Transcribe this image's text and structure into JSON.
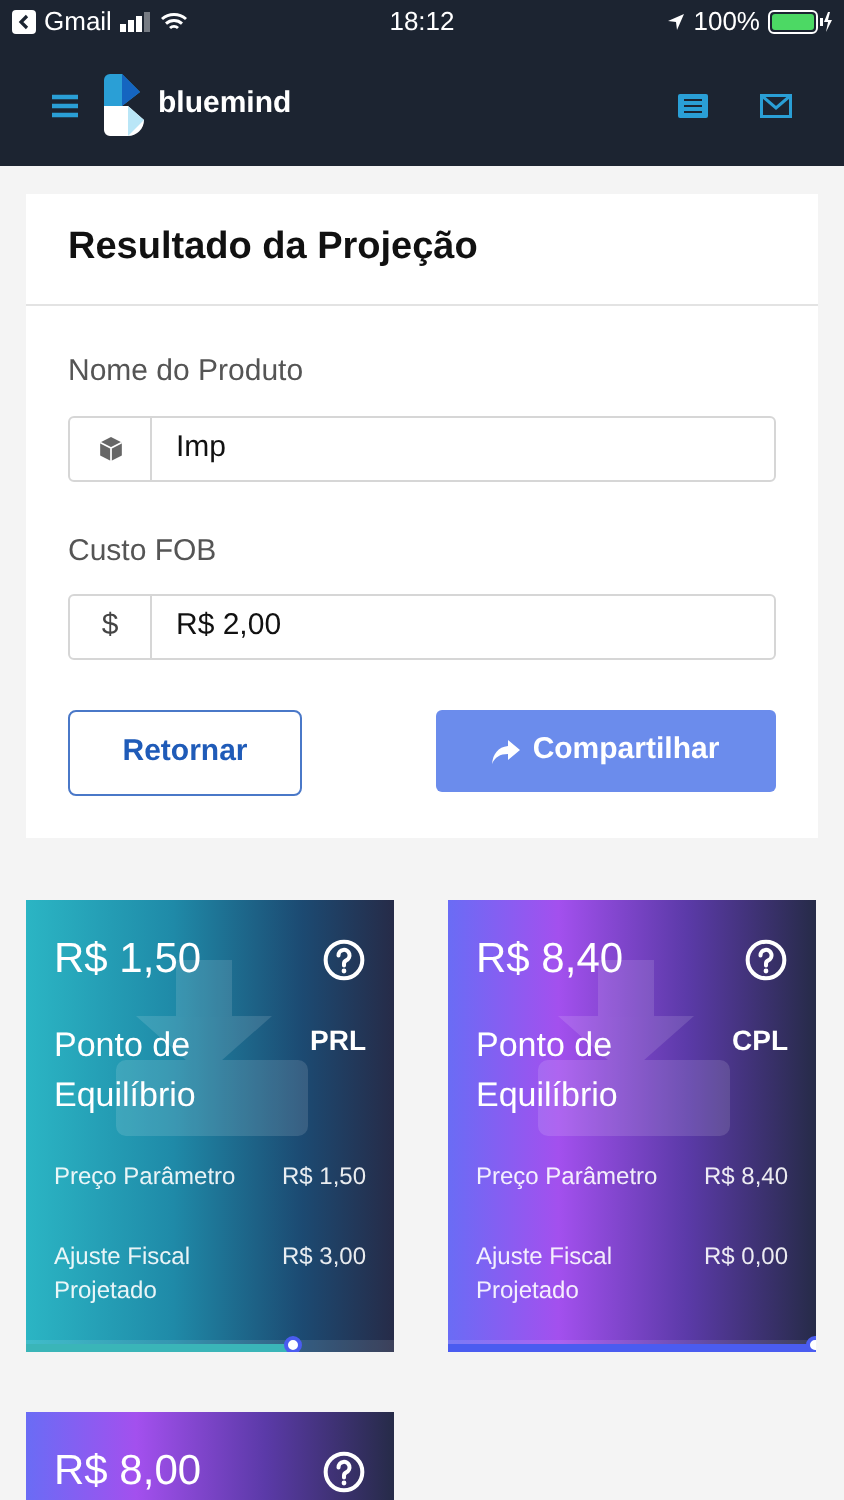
{
  "status_bar": {
    "back_app": "Gmail",
    "time": "18:12",
    "battery": "100%"
  },
  "header": {
    "brand": "bluemind"
  },
  "form": {
    "title": "Resultado da Projeção",
    "fields": [
      {
        "label": "Nome do Produto",
        "kind": "box",
        "value": "Imp"
      },
      {
        "label": "Custo FOB",
        "kind": "text",
        "addon": "$",
        "value": "R$ 2,00"
      }
    ],
    "buttons": [
      {
        "label": "Retornar",
        "kind": "outline"
      },
      {
        "label": "Compartilhar",
        "kind": "share"
      }
    ]
  },
  "cards": [
    {
      "price": "R$ 1,50",
      "title": "Ponto de Equilíbrio",
      "code": "PRL",
      "kind": "teal",
      "rows": [
        {
          "label": "Preço Parâmetro",
          "value": "R$ 1,50"
        },
        {
          "label": "Ajuste Fiscal Projetado",
          "value": "R$ 3,00"
        }
      ],
      "level": 0.73
    },
    {
      "price": "R$ 8,40",
      "title": "Ponto de Equilíbrio",
      "code": "CPL",
      "kind": "purple",
      "rows": [
        {
          "label": "Preço Parâmetro",
          "value": "R$ 8,40"
        },
        {
          "label": "Ajuste Fiscal Projetado",
          "value": "R$ 0,00"
        }
      ],
      "level": 1
    },
    {
      "price": "R$ 8,00",
      "kind": "purple"
    }
  ]
}
